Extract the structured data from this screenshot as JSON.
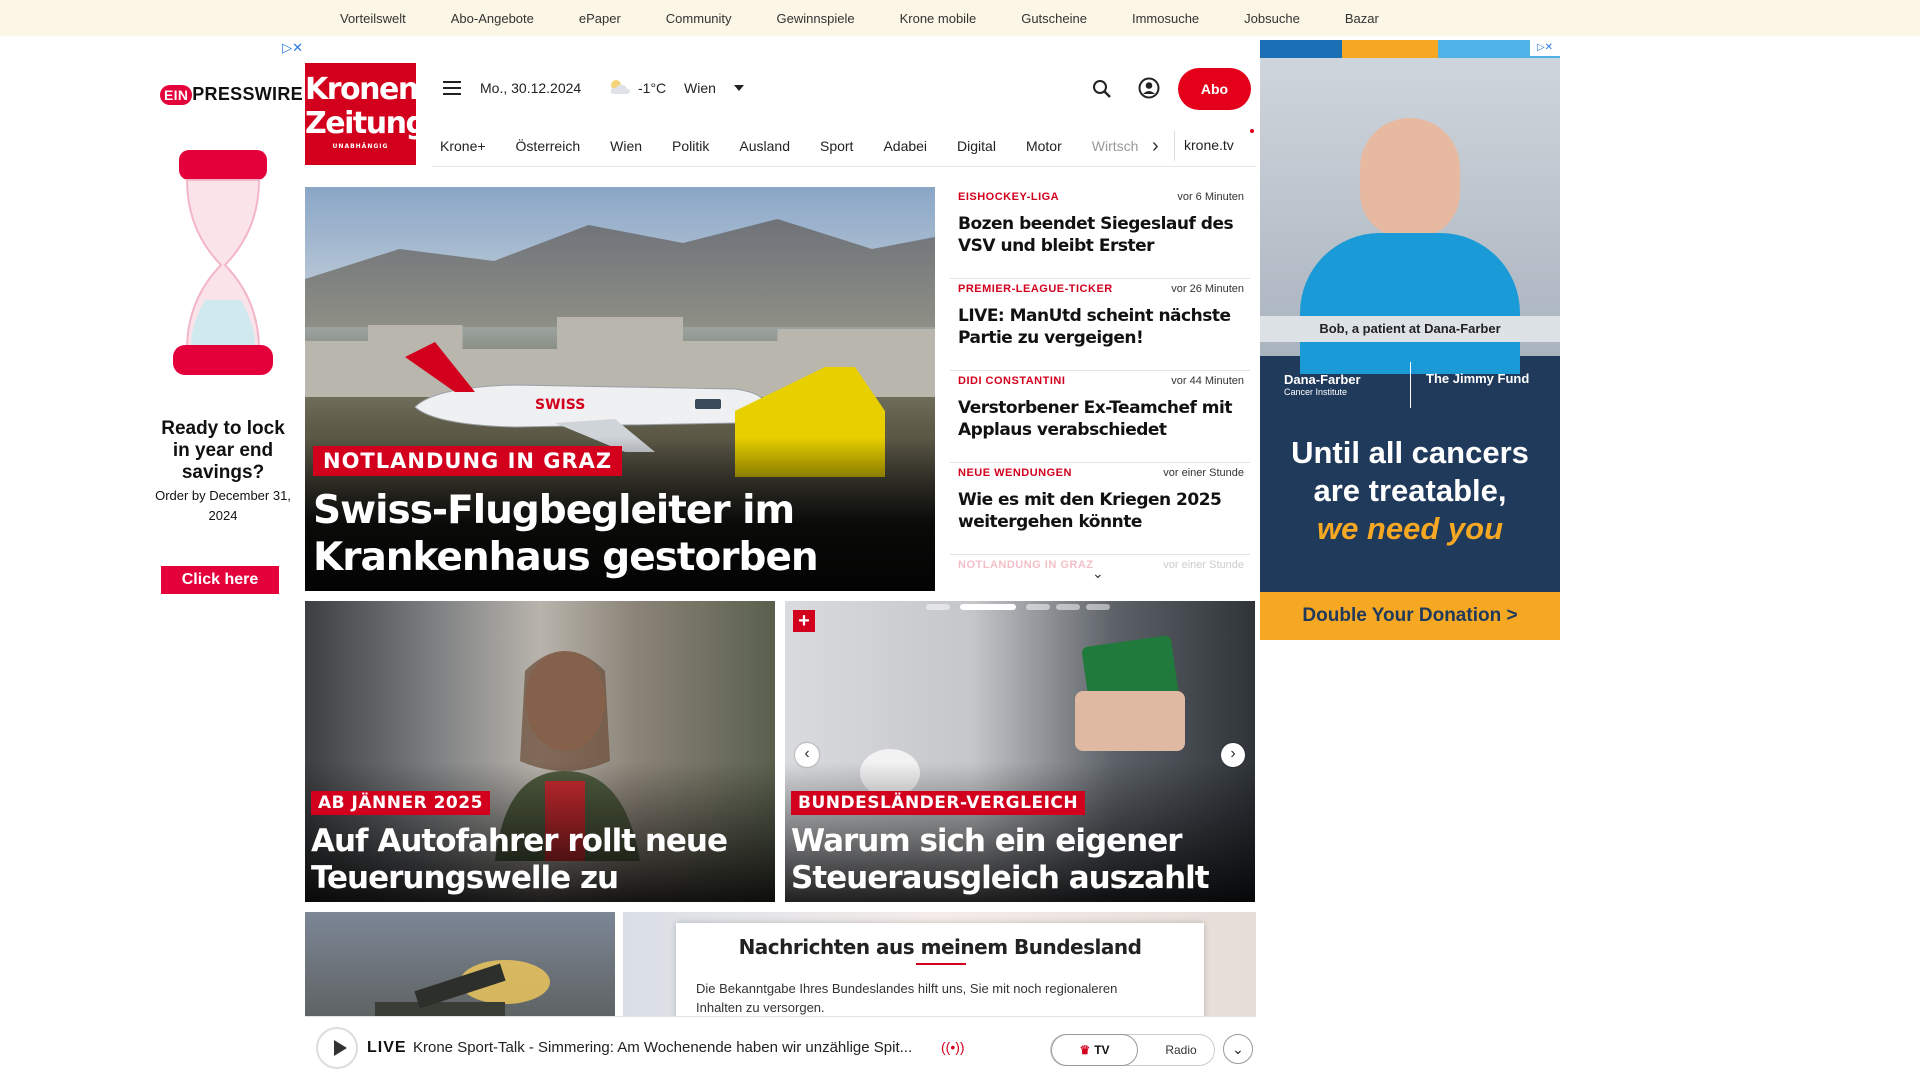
{
  "topnav": [
    "Vorteilswelt",
    "Abo-Angebote",
    "ePaper",
    "Community",
    "Gewinnspiele",
    "Krone mobile",
    "Gutscheine",
    "Immosuche",
    "Jobsuche",
    "Bazar"
  ],
  "ad_left": {
    "brand_ein": "EIN",
    "brand_rest": "PRESSWIRE",
    "headline": "Ready to lock in year end savings?",
    "sub": "Order by December 31, 2024",
    "cta": "Click here"
  },
  "logo": {
    "line1": "Kronen",
    "line2": "Zeitung",
    "tagline": "UNABHÄNGIG"
  },
  "header": {
    "date": "Mo., 30.12.2024",
    "temp": "-1°C",
    "city": "Wien",
    "abo": "Abo"
  },
  "nav": {
    "items": [
      "Krone+",
      "Österreich",
      "Wien",
      "Politik",
      "Ausland",
      "Sport",
      "Adabei",
      "Digital",
      "Motor",
      "Wirtsch"
    ],
    "kronetv": "krone.tv"
  },
  "hero": {
    "kicker": "NOTLANDUNG IN GRAZ",
    "title": "Swiss-Flugbegleiter im Krankenhaus gestorben",
    "plane_brand": "SWISS"
  },
  "news": [
    {
      "cat": "EISHOCKEY-LIGA",
      "time": "vor 6 Minuten",
      "headline": "Bozen beendet Siegeslauf des VSV und bleibt Erster"
    },
    {
      "cat": "PREMIER-LEAGUE-TICKER",
      "time": "vor 26 Minuten",
      "headline": "LIVE: ManUtd scheint nächste Partie zu vergeigen!"
    },
    {
      "cat": "DIDI CONSTANTINI",
      "time": "vor 44 Minuten",
      "headline": "Verstorbener Ex-Teamchef mit Applaus verabschiedet"
    },
    {
      "cat": "NEUE WENDUNGEN",
      "time": "vor einer Stunde",
      "headline": "Wie es mit den Kriegen 2025 weitergehen könnte"
    },
    {
      "cat": "NOTLANDUNG IN GRAZ",
      "time": "vor einer Stunde",
      "headline": ""
    }
  ],
  "ad_right": {
    "caption": "Bob, a patient at Dana-Farber",
    "df_name": "Dana-Farber",
    "df_sub": "Cancer Institute",
    "jf_name": "The Jimmy Fund",
    "big_line": "Until all cancers are treatable,",
    "big_em": "we need you",
    "donate": "Double Your Donation >"
  },
  "cards": [
    {
      "kicker": "AB JÄNNER 2025",
      "title": "Auf Autofahrer rollt neue Teuerungswelle zu"
    },
    {
      "kicker": "BUNDESLÄNDER-VERGLEICH",
      "title": "Warum sich ein eigener Steuerausgleich auszahlt"
    }
  ],
  "bundesland": {
    "title": "Nachrichten aus meinem Bundesland",
    "text": "Die Bekanntgabe Ihres Bundeslandes hilft uns, Sie mit noch regionaleren Inhalten zu versorgen."
  },
  "player": {
    "live": "LIVE",
    "title": "Krone Sport-Talk - Simmering: Am Wochenende haben wir unzählige Spit...",
    "tv": "TV",
    "radio": "Radio"
  },
  "colors": {
    "brand_red": "#d3001d",
    "abo_red": "#e4001b",
    "topbar_bg": "#fbf6e6",
    "ad_navy": "#203a5c",
    "ad_orange": "#f7a823"
  }
}
